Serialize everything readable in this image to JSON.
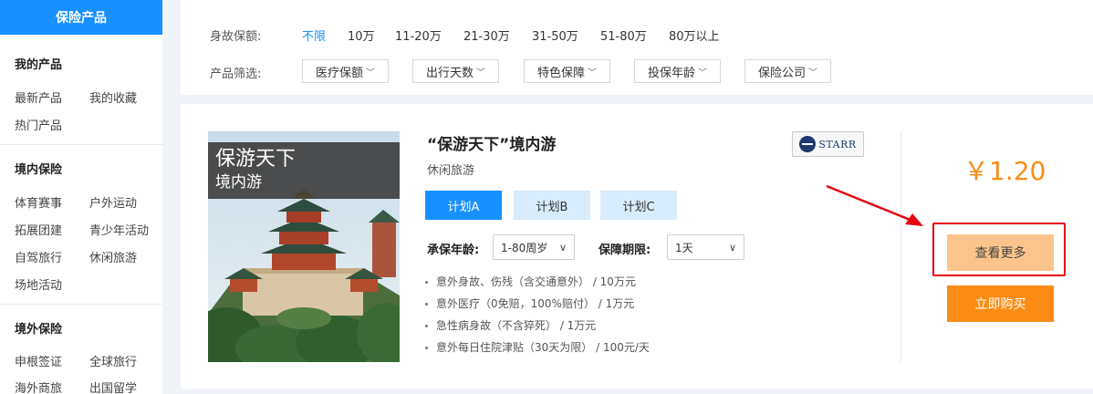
{
  "sidebar": {
    "header": "保险产品",
    "groups": [
      {
        "title": "我的产品",
        "items": [
          "最新产品",
          "我的收藏",
          "热门产品"
        ]
      },
      {
        "title": "境内保险",
        "items": [
          "体育赛事",
          "户外运动",
          "拓展团建",
          "青少年活动",
          "自驾旅行",
          "休闲旅游",
          "场地活动"
        ]
      },
      {
        "title": "境外保险",
        "items": [
          "申根签证",
          "全球旅行",
          "海外商旅",
          "出国留学"
        ]
      }
    ]
  },
  "filters": {
    "amount_label": "身故保额:",
    "amount_options": [
      "不限",
      "10万",
      "11-20万",
      "21-30万",
      "31-50万",
      "51-80万",
      "80万以上"
    ],
    "amount_selected": "不限",
    "product_label": "产品筛选:",
    "dropdowns": [
      "医疗保额",
      "出行天数",
      "特色保障",
      "投保年龄",
      "保险公司"
    ]
  },
  "product": {
    "image_title_line1": "保游天下",
    "image_title_line2": "境内游",
    "title": "“保游天下”境内游",
    "subtitle": "休闲旅游",
    "insurer_logo": "STARR",
    "plans": [
      "计划A",
      "计划B",
      "计划C"
    ],
    "plan_selected": "计划A",
    "age_label": "承保年龄:",
    "age_value": "1-80周岁",
    "period_label": "保障期限:",
    "period_value": "1天",
    "benefits": [
      "意外身故、伤残（含交通意外） / 10万元",
      "意外医疗（0免赔，100%赔付） / 1万元",
      "急性病身故（不含猝死） / 1万元",
      "意外每日住院津贴（30天为限） / 100元/天"
    ],
    "price": "￥1.20",
    "btn_more": "查看更多",
    "btn_buy": "立即购买"
  },
  "colors": {
    "primary": "#1890ff",
    "price": "#fa8c16",
    "more_button": "#fcc48d",
    "annotation": "#e60012"
  }
}
